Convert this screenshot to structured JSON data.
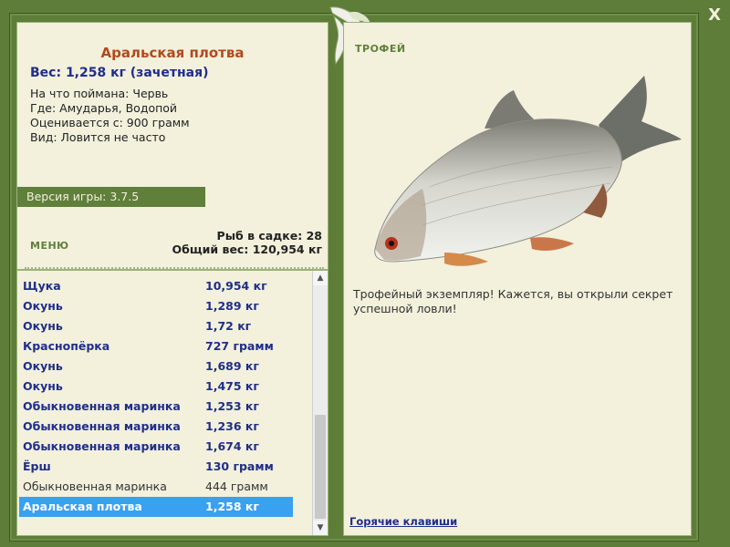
{
  "fish": {
    "name": "Аральская плотва",
    "weight": "Вес: 1,258 кг (зачетная)",
    "bait": "На что поймана: Червь",
    "place": "Где: Амударья, Водопой",
    "value": "Оценивается с: 900 грамм",
    "rarity": "Вид: Ловится не часто"
  },
  "version": "Версия игры: 3.7.5",
  "menu_label": "МЕНЮ",
  "stats": {
    "count": "Рыб в садке: 28",
    "total": "Общий вес: 120,954 кг"
  },
  "catch_list": [
    {
      "name": "Щука",
      "weight": "10,954 кг"
    },
    {
      "name": "Окунь",
      "weight": "1,289 кг"
    },
    {
      "name": "Окунь",
      "weight": "1,72 кг"
    },
    {
      "name": "Краснопёрка",
      "weight": "727 грамм"
    },
    {
      "name": "Окунь",
      "weight": "1,689 кг"
    },
    {
      "name": "Окунь",
      "weight": "1,475 кг"
    },
    {
      "name": "Обыкновенная маринка",
      "weight": "1,253 кг"
    },
    {
      "name": "Обыкновенная маринка",
      "weight": "1,236 кг"
    },
    {
      "name": "Обыкновенная маринка",
      "weight": "1,674 кг"
    },
    {
      "name": "Ёрш",
      "weight": "130 грамм"
    },
    {
      "name": "Обыкновенная маринка",
      "weight": "444 грамм"
    },
    {
      "name": "Аральская плотва",
      "weight": "1,258 кг"
    }
  ],
  "trophy_label": "ТРОФЕЙ",
  "description": "Трофейный экземпляр! Кажется, вы открыли секрет успешной ловли!",
  "hotkeys": "Горячие клавиши",
  "close": "X",
  "icons": {
    "close": "close-icon",
    "logo": "leaf-fish-logo",
    "scroll_up": "arrow-up-icon",
    "scroll_down": "arrow-down-icon"
  },
  "colors": {
    "frame": "#5f7f3b",
    "panel": "#f3f0dc",
    "title": "#b14a1c",
    "accent": "#1f2e8a",
    "selected": "#3aa0f0"
  }
}
